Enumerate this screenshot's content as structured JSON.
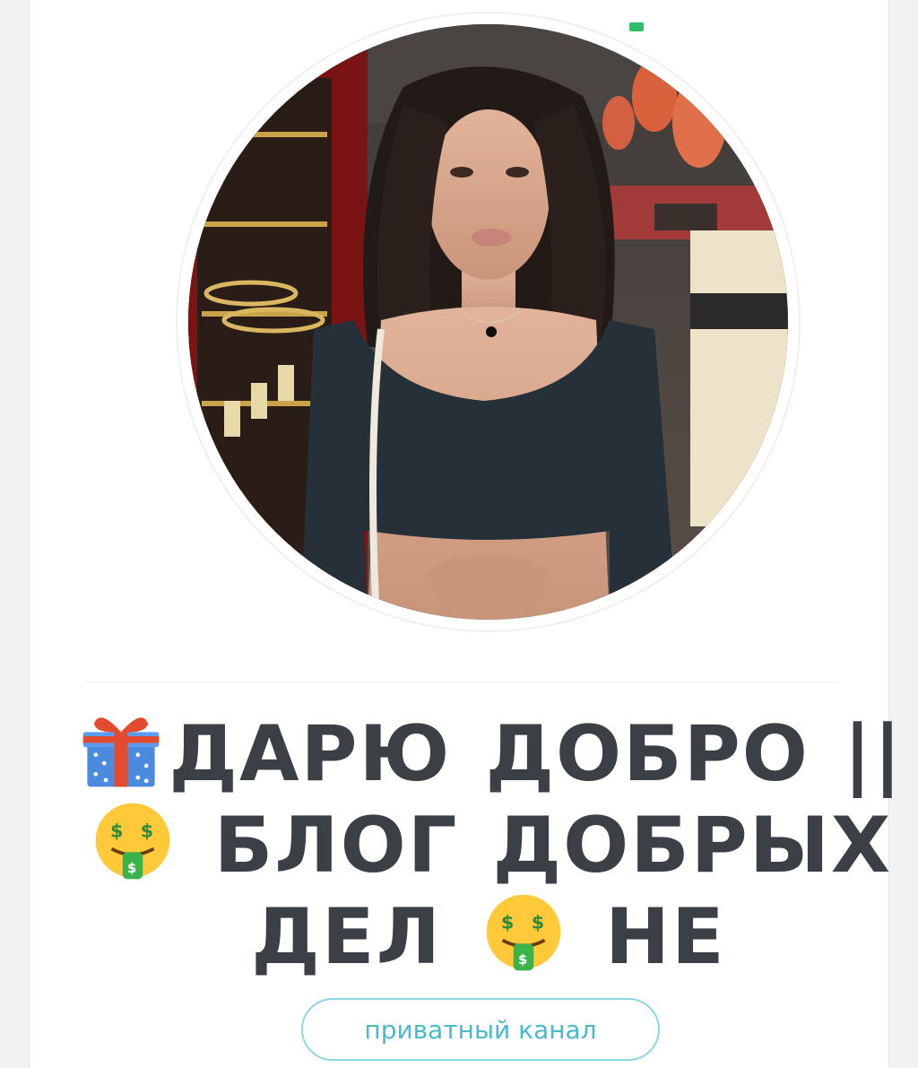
{
  "channel": {
    "title_lines": [
      {
        "emoji": "gift-icon",
        "text": "ДАРЮ ДОБРО ||"
      },
      {
        "emoji": "money-mouth-face-icon",
        "text": "БЛОГ ДОБРЫХ"
      },
      {
        "text_before": "ДЕЛ",
        "emoji": "money-mouth-face-icon",
        "text_after": "НЕ"
      }
    ],
    "title_full": "🎁ДАРЮ ДОБРО || 🤑 БЛОГ ДОБРЫХ ДЕЛ 🤑 НЕ",
    "type_label": "приватный канал"
  },
  "colors": {
    "background": "#f1f2f4",
    "card": "#ffffff",
    "title_text": "#3b4047",
    "accent": "#49b9cc",
    "pill_border": "#8fd6e0",
    "online_dot": "#2fbf6b"
  }
}
